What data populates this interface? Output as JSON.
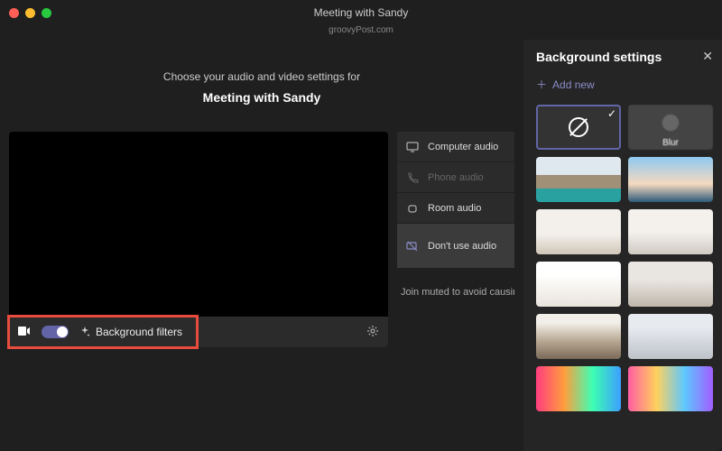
{
  "window": {
    "title": "Meeting with Sandy",
    "domain": "groovyPost.com"
  },
  "prompt": {
    "sub": "Choose your audio and video settings for",
    "main": "Meeting with Sandy"
  },
  "controls": {
    "bg_filters_label": "Background filters"
  },
  "audio": {
    "computer": "Computer audio",
    "phone": "Phone audio",
    "room": "Room audio",
    "none": "Don't use audio",
    "mute_note": "Join muted to avoid causing"
  },
  "panel": {
    "title": "Background settings",
    "add_new": "Add new",
    "tiles": {
      "none": "None",
      "blur": "Blur"
    }
  },
  "colors": {
    "accent": "#6264a7",
    "highlight": "#e84c3d"
  }
}
